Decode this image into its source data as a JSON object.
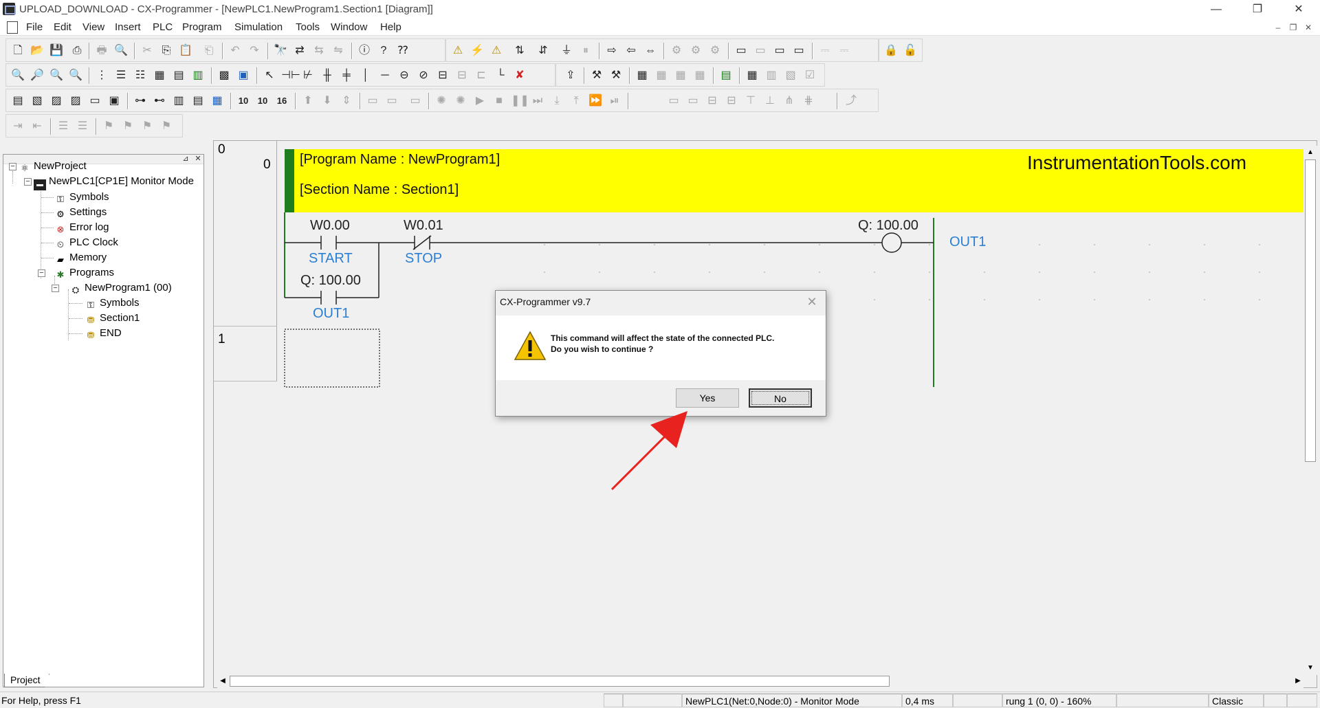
{
  "window": {
    "title": "UPLOAD_DOWNLOAD - CX-Programmer - [NewPLC1.NewProgram1.Section1 [Diagram]]",
    "minimize": "—",
    "restore": "❐",
    "close": "✕"
  },
  "menu": {
    "items": [
      "File",
      "Edit",
      "View",
      "Insert",
      "PLC",
      "Program",
      "Simulation",
      "Tools",
      "Window",
      "Help"
    ]
  },
  "tree": {
    "project": "NewProject",
    "plc": "NewPLC1[CP1E] Monitor Mode",
    "symbols": "Symbols",
    "settings": "Settings",
    "error_log": "Error log",
    "plc_clock": "PLC Clock",
    "memory": "Memory",
    "programs": "Programs",
    "program": "NewProgram1 (00)",
    "prog_symbols": "Symbols",
    "section": "Section1",
    "end": "END",
    "tab": "Project"
  },
  "diagram": {
    "rung0_num": "0",
    "rung0_step": "0",
    "rung1_num": "1",
    "program_name": "[Program Name : NewProgram1]",
    "section_name": "[Section Name : Section1]",
    "watermark": "InstrumentationTools.com",
    "contact1_addr": "W0.00",
    "contact1_name": "START",
    "contact2_addr": "W0.01",
    "contact2_name": "STOP",
    "contact3_addr": "Q: 100.00",
    "contact3_name": "OUT1",
    "coil_addr": "Q: 100.00",
    "coil_name": "OUT1"
  },
  "dialog": {
    "title": "CX-Programmer v9.7",
    "line1": "This command will affect the state of the connected PLC.",
    "line2": "Do you wish to continue ?",
    "yes": "Yes",
    "no": "No",
    "close": "✕"
  },
  "status": {
    "help": "For Help, press F1",
    "connection": "NewPLC1(Net:0,Node:0) - Monitor Mode",
    "cycle": "0,4 ms",
    "position": "rung 1 (0, 0)  - 160%",
    "mode": "Classic"
  },
  "colors": {
    "header_band": "#ffff00",
    "rung_bar": "#1e7d1e",
    "symbol_name": "#2a7fd4",
    "arrow": "#e8231f"
  }
}
